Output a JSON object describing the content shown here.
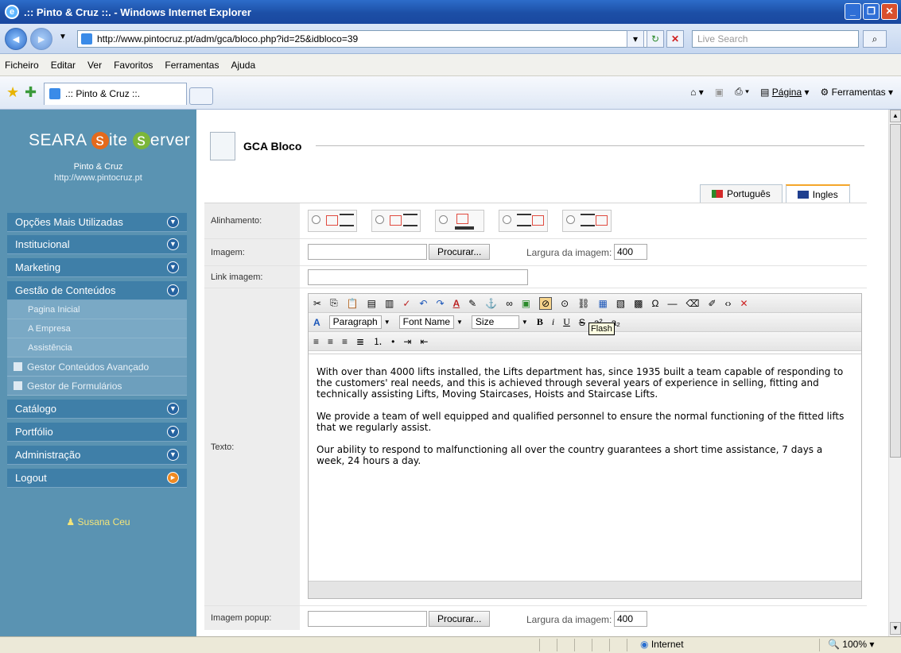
{
  "window": {
    "title": ".:: Pinto & Cruz ::. - Windows Internet Explorer"
  },
  "browser": {
    "url": "http://www.pintocruz.pt/adm/gca/bloco.php?id=25&idbloco=39",
    "search_placeholder": "Live Search",
    "menu": [
      "Ficheiro",
      "Editar",
      "Ver",
      "Favoritos",
      "Ferramentas",
      "Ajuda"
    ],
    "tab_label": ".:: Pinto & Cruz ::.",
    "cmd_pagina": "Página",
    "cmd_ferramentas": "Ferramentas"
  },
  "sidebar": {
    "logo_pre": "SEARA ",
    "logo_s": "s",
    "logo_mid": "ite ",
    "logo_s2": "s",
    "logo_post": "erver",
    "org_name": "Pinto & Cruz",
    "org_url": "http://www.pintocruz.pt",
    "menu_top": [
      "Opções Mais Utilizadas",
      "Institucional",
      "Marketing",
      "Gestão de Conteúdos"
    ],
    "submenu": [
      "Pagina Inicial",
      "A Empresa",
      "Assistência"
    ],
    "submenu_icons": [
      "Gestor Conteúdos Avançado",
      "Gestor de Formulários"
    ],
    "menu_bottom": [
      "Catálogo",
      "Portfólio",
      "Administração",
      "Logout"
    ],
    "user": "Susana Ceu"
  },
  "main": {
    "title": "GCA Bloco",
    "lang_tabs": [
      "Português",
      "Ingles"
    ],
    "labels": {
      "alinhamento": "Alinhamento:",
      "imagem": "Imagem:",
      "link_imagem": "Link imagem:",
      "texto": "Texto:",
      "imagem_popup": "Imagem popup:"
    },
    "procurar": "Procurar...",
    "largura_label": "Largura da imagem:",
    "largura_value": "400",
    "editor": {
      "format": "Paragraph",
      "font": "Font Name",
      "size": "Size",
      "tooltip": "Flash",
      "paragraphs": [
        "With over than 4000 lifts installed, the Lifts department has, since 1935 built a team capable of responding to the customers' real needs, and this is achieved through several years of experience in selling, fitting and technically assisting Lifts, Moving Staircases, Hoists and Staircase Lifts.",
        "We provide a team of well equipped and qualified personnel to ensure the normal functioning of the fitted lifts that we regularly assist.",
        "Our ability to respond to malfunctioning all over the country guarantees a short time assistance, 7 days a week, 24 hours a day."
      ]
    }
  },
  "statusbar": {
    "zone": "Internet",
    "zoom": "100%"
  }
}
